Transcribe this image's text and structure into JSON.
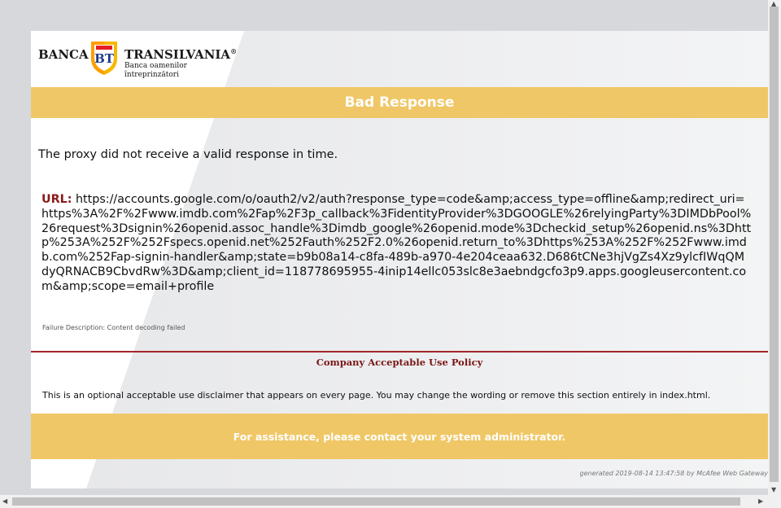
{
  "logo": {
    "banca": "BANCA",
    "bt": "BT",
    "transilvania": "TRANSILVANIA",
    "registered": "®",
    "tagline_line1": "Banca oamenilor",
    "tagline_line2": "întreprinzători"
  },
  "title": "Bad Response",
  "message": "The proxy did not receive a valid response in time.",
  "url": {
    "label": "URL:",
    "value": "https://accounts.google.com/o/oauth2/v2/auth?response_type=code&amp;access_type=offline&amp;redirect_uri=https%3A%2F%2Fwww.imdb.com%2Fap%2F3p_callback%3FidentityProvider%3DGOOGLE%26relyingParty%3DIMDbPool%26request%3Dsignin%26openid.assoc_handle%3Dimdb_google%26openid.mode%3Dcheckid_setup%26openid.ns%3Dhttp%253A%252F%252Fspecs.openid.net%252Fauth%252F2.0%26openid.return_to%3Dhttps%253A%252F%252Fwww.imdb.com%252Fap-signin-handler&amp;state=b9b08a14-c8fa-489b-a970-4e204ceaa632.D686tCNe3hjVgZs4Xz9ylcfIWqQMdyQRNACB9CbvdRw%3D&amp;client_id=118778695955-4inip14ellc053slc8e3aebndgcfo3p9.apps.googleusercontent.com&amp;scope=email+profile"
  },
  "failure": {
    "label": "Failure Description:",
    "value": "Content decoding failed"
  },
  "policy": {
    "title": "Company Acceptable Use Policy",
    "text": "This is an optional acceptable use disclaimer that appears on every page. You may change the wording or remove this section entirely in index.html."
  },
  "assistance": "For assistance, please contact your system administrator.",
  "generated": "generated 2019-08-14 13:47:58 by McAfee Web Gateway",
  "colors": {
    "accent_yellow": "#f0c766",
    "dark_red": "#a3262a",
    "url_label": "#8b1a1a",
    "background": "#d6d8db"
  }
}
